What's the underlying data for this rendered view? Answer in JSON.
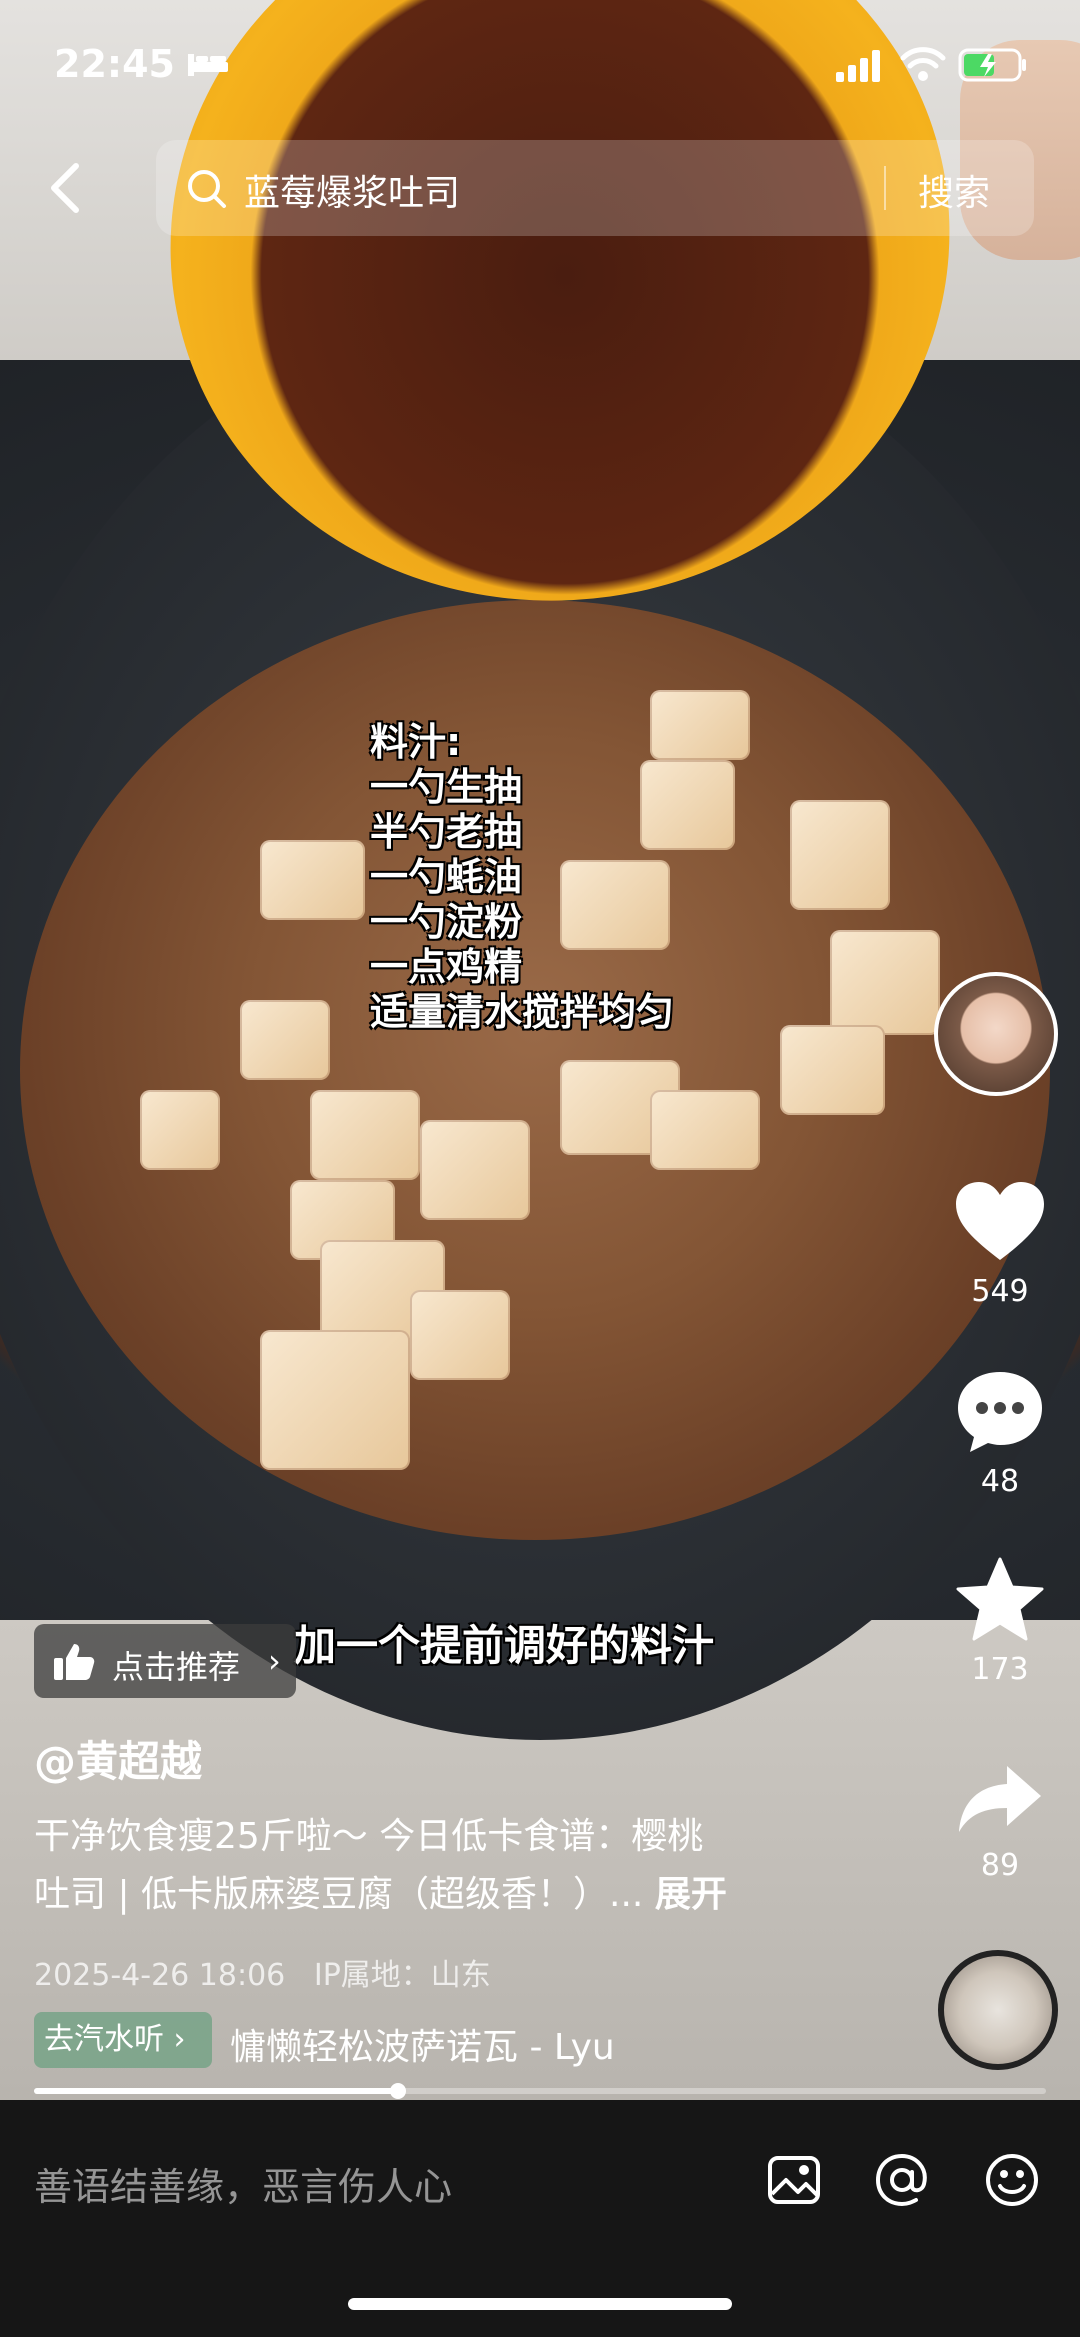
{
  "status_bar": {
    "time": "22:45"
  },
  "search": {
    "query": "蓝莓爆浆吐司",
    "button_label": "搜索"
  },
  "overlay": {
    "recipe_lines": [
      "料汁:",
      "一勺生抽",
      "半勺老抽",
      "一勺蚝油",
      "一勺淀粉",
      "一点鸡精",
      "适量清水搅拌均匀"
    ],
    "subtitle": "加一个提前调好的料汁"
  },
  "actions": {
    "likes": "549",
    "comments": "48",
    "favorites": "173",
    "shares": "89"
  },
  "post": {
    "recommend_label": "点击推荐",
    "author": "@黄超越",
    "description_line1": "干净饮食瘦25斤啦～ 今日低卡食谱：樱桃",
    "description_line2": "吐司 | 低卡版麻婆豆腐（超级香！）...",
    "expand_label": "展开",
    "timestamp": "2025-4-26 18:06",
    "location": "IP属地：山东",
    "music_tag": "去汽水听",
    "music_title": "慵懒轻松波萨诺瓦 - Lyu",
    "progress_fraction": 0.36
  },
  "comment_bar": {
    "placeholder": "善语结善缘，恶言伤人心"
  },
  "colors": {
    "accent_music_tag": "#6ea082",
    "comment_bar_bg": "#161616"
  },
  "icons": [
    "search-icon",
    "back-chevron-icon",
    "heart-icon",
    "comment-icon",
    "star-icon",
    "share-icon",
    "image-icon",
    "at-icon",
    "emoji-icon",
    "thumb-up-icon"
  ]
}
